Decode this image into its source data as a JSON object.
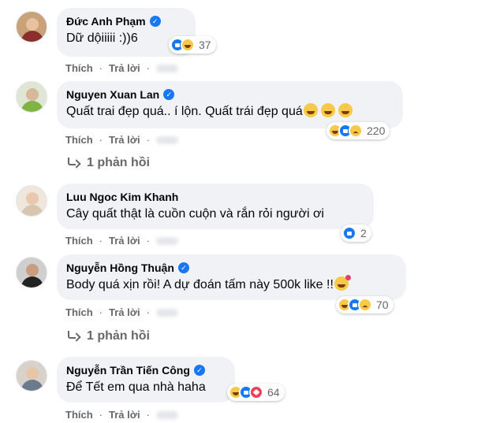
{
  "comments": [
    {
      "author": "Đức Anh Phạm",
      "verified": true,
      "text": "Dữ dộiiiii :))6",
      "text_emoji": [],
      "reactions": [
        "like",
        "haha"
      ],
      "reaction_count": "37",
      "like_label": "Thích",
      "reply_label": "Trả lời",
      "replies_label": ""
    },
    {
      "author": "Nguyen Xuan Lan",
      "verified": true,
      "text": "Quất trai đẹp quá.. í lộn. Quất trái đẹp quá",
      "text_emoji": [
        "tongue-wink",
        "tongue-wink",
        "tongue-wink"
      ],
      "reactions": [
        "haha",
        "like",
        "sad"
      ],
      "reaction_count": "220",
      "like_label": "Thích",
      "reply_label": "Trả lời",
      "replies_label": "1 phản hồi"
    },
    {
      "author": "Luu Ngoc Kim Khanh",
      "verified": false,
      "text": "Cây quất thật là cuồn cuộn và rắn rỏi người ơi",
      "text_emoji": [],
      "reactions": [
        "like"
      ],
      "reaction_count": "2",
      "like_label": "Thích",
      "reply_label": "Trả lời",
      "replies_label": ""
    },
    {
      "author": "Nguyễn Hồng Thuận",
      "verified": true,
      "text": "Body quá xịn rồi! A dự đoán tấm này 500k like !!",
      "text_emoji": [
        "smiling-hearts"
      ],
      "reactions": [
        "haha",
        "like",
        "sad"
      ],
      "reaction_count": "70",
      "like_label": "Thích",
      "reply_label": "Trả lời",
      "replies_label": "1 phản hồi"
    },
    {
      "author": "Nguyễn Trần Tiến Công",
      "verified": true,
      "text": "Để Tết em qua nhà haha",
      "text_emoji": [],
      "reactions": [
        "haha",
        "like",
        "love"
      ],
      "reaction_count": "64",
      "like_label": "Thích",
      "reply_label": "Trả lời",
      "replies_label": ""
    }
  ],
  "colors": {
    "bubble": "#f0f2f5",
    "facebook_blue": "#1877f2",
    "secondary_text": "#65676b"
  }
}
